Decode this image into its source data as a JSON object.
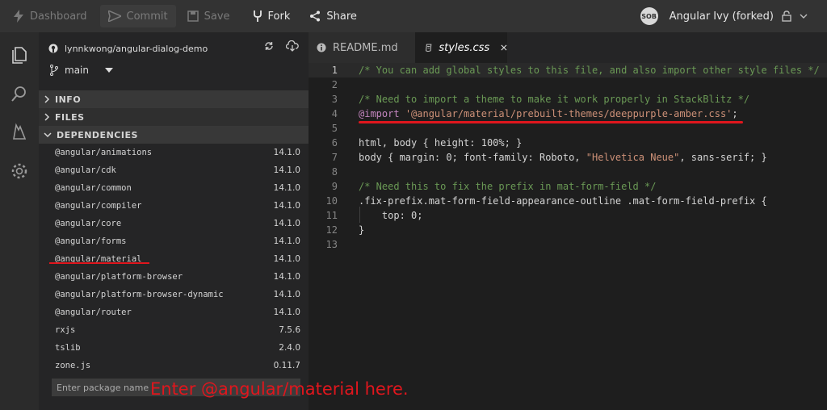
{
  "topbar": {
    "dashboard": "Dashboard",
    "commit": "Commit",
    "save": "Save",
    "fork": "Fork",
    "share": "Share",
    "project_name": "Angular Ivy (forked)",
    "avatar_text": "SOB"
  },
  "sidebar": {
    "repo": "lynnkwong/angular-dialog-demo",
    "branch": "main",
    "sections": {
      "info": "INFO",
      "files": "FILES",
      "dependencies": "DEPENDENCIES"
    },
    "dependencies": [
      {
        "name": "@angular/animations",
        "version": "14.1.0"
      },
      {
        "name": "@angular/cdk",
        "version": "14.1.0"
      },
      {
        "name": "@angular/common",
        "version": "14.1.0"
      },
      {
        "name": "@angular/compiler",
        "version": "14.1.0"
      },
      {
        "name": "@angular/core",
        "version": "14.1.0"
      },
      {
        "name": "@angular/forms",
        "version": "14.1.0"
      },
      {
        "name": "@angular/material",
        "version": "14.1.0"
      },
      {
        "name": "@angular/platform-browser",
        "version": "14.1.0"
      },
      {
        "name": "@angular/platform-browser-dynamic",
        "version": "14.1.0"
      },
      {
        "name": "@angular/router",
        "version": "14.1.0"
      },
      {
        "name": "rxjs",
        "version": "7.5.6"
      },
      {
        "name": "tslib",
        "version": "2.4.0"
      },
      {
        "name": "zone.js",
        "version": "0.11.7"
      }
    ],
    "package_placeholder": "Enter package name"
  },
  "editor": {
    "tabs": [
      {
        "label": "README.md"
      },
      {
        "label": "styles.css"
      }
    ],
    "lines": [
      "1",
      "2",
      "3",
      "4",
      "5",
      "6",
      "7",
      "8",
      "9",
      "10",
      "11",
      "12",
      "13"
    ],
    "code": {
      "l1": "/* You can add global styles to this file, and also import other style files */",
      "l3": "/* Need to import a theme to make it work properly in StackBlitz */",
      "l4_kw": "@import",
      "l4_str": "'@angular/material/prebuilt-themes/deeppurple-amber.css'",
      "l4_end": ";",
      "l6": "html, body { height: 100%; }",
      "l7a": "body { margin: 0; font-family: Roboto, ",
      "l7_str": "\"Helvetica Neue\"",
      "l7b": ", sans-serif; }",
      "l9": "/* Need this to fix the prefix in mat-form-field */",
      "l10": ".fix-prefix.mat-form-field-appearance-outline .mat-form-field-prefix {",
      "l11": "    top: 0;",
      "l12": "}"
    }
  },
  "annotation": "Enter @angular/material here."
}
